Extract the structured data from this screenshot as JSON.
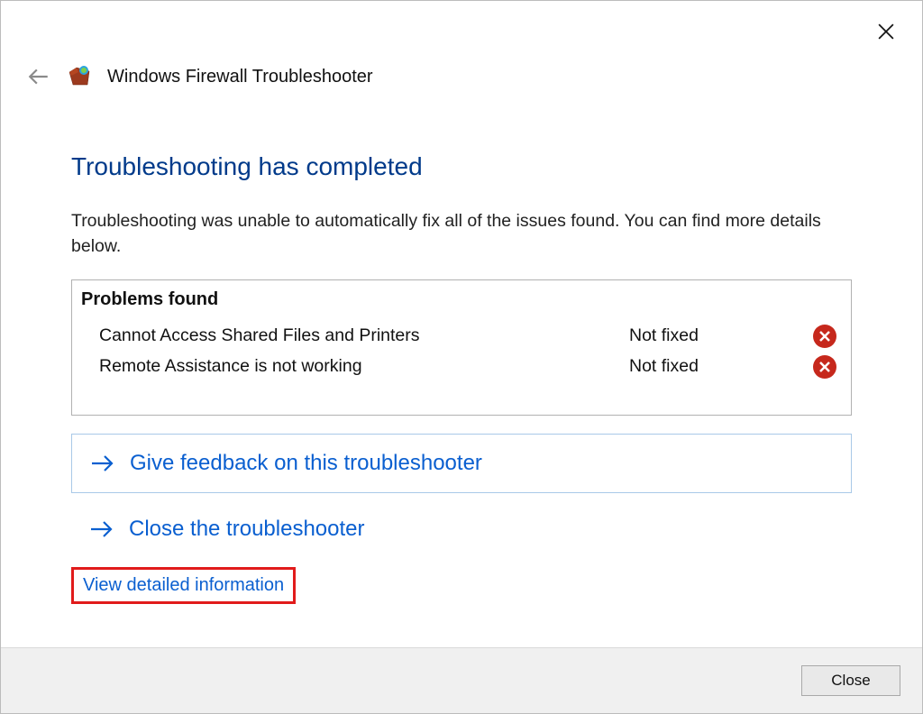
{
  "window": {
    "title": "Windows Firewall Troubleshooter",
    "close_label": "Close"
  },
  "main": {
    "heading": "Troubleshooting has completed",
    "description": "Troubleshooting was unable to automatically fix all of the issues found. You can find more details below."
  },
  "problems": {
    "title": "Problems found",
    "items": [
      {
        "name": "Cannot Access Shared Files and Printers",
        "status": "Not fixed",
        "state": "error"
      },
      {
        "name": "Remote Assistance is not working",
        "status": "Not fixed",
        "state": "error"
      }
    ]
  },
  "options": {
    "feedback_label": "Give feedback on this troubleshooter",
    "close_ts_label": "Close the troubleshooter",
    "view_detailed_label": "View detailed information"
  },
  "footer": {
    "close_button": "Close"
  }
}
